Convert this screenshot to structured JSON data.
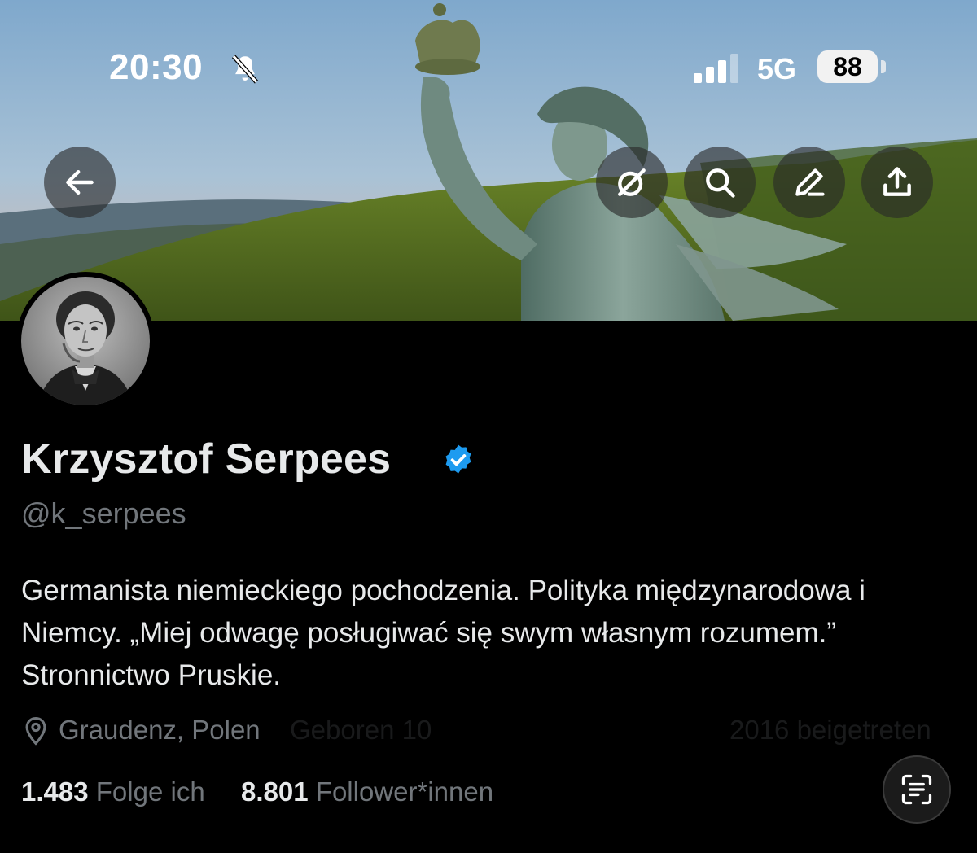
{
  "status_bar": {
    "time": "20:30",
    "network": "5G",
    "battery": "88",
    "icons": [
      "bell-slash-icon",
      "signal-icon"
    ]
  },
  "header": {
    "buttons": [
      "back-arrow-icon",
      "grok-icon",
      "search-icon",
      "edit-icon",
      "share-icon"
    ]
  },
  "profile": {
    "display_name": "Krzysztof Serpees",
    "verified": true,
    "handle": "@k_serpees",
    "bio": "Germanista niemieckiego pochodzenia. Polityka międzynarodowa i Niemcy. „Miej odwagę posługiwać się swym własnym rozumem.” Stronnictwo Pruskie.",
    "location": "Graudenz, Polen",
    "faded_text_1": "Geboren 10",
    "faded_text_2": "2016 beigetreten",
    "following_count": "1.483",
    "following_label": "Folge ich",
    "followers_count": "8.801",
    "followers_label": "Follower*innen"
  },
  "colors": {
    "background": "#000000",
    "text_primary": "#e7e9ea",
    "text_secondary": "#71767b",
    "verified": "#1d9bf0"
  }
}
